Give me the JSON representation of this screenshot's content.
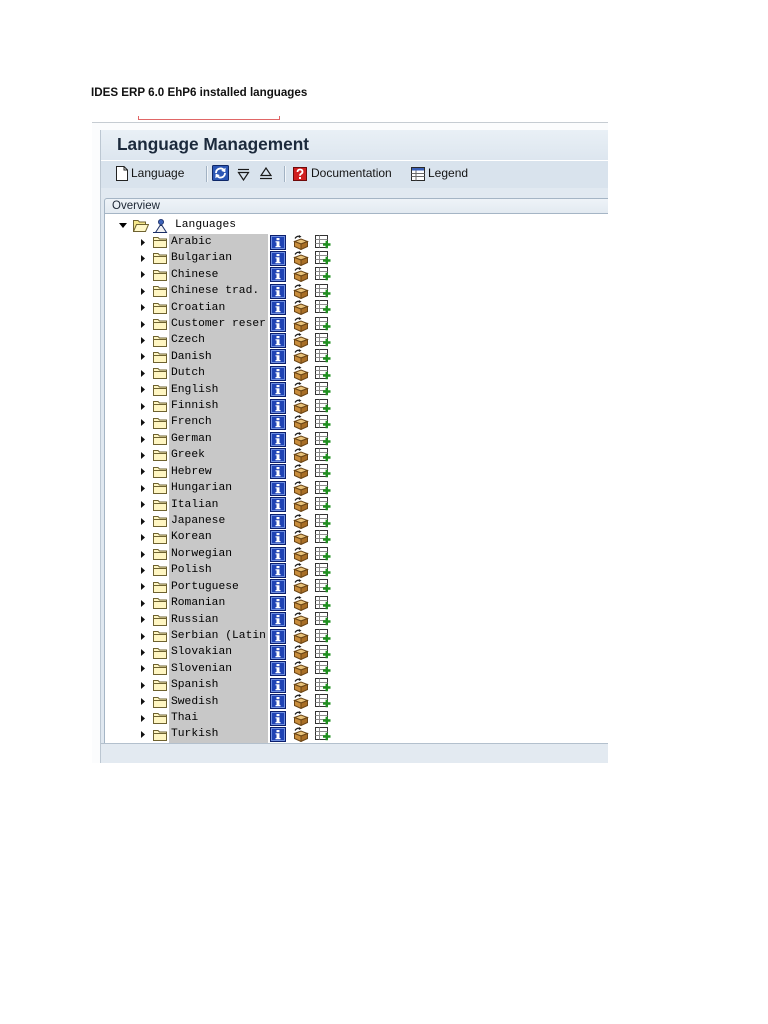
{
  "document": {
    "caption": "IDES ERP 6.0 EhP6 installed languages"
  },
  "window": {
    "title": "Language Management"
  },
  "toolbar": {
    "items": [
      {
        "icon": "new-document-icon",
        "label": "Language"
      },
      {
        "icon": "refresh-icon"
      },
      {
        "icon": "expand-all-icon"
      },
      {
        "icon": "collapse-all-icon"
      },
      {
        "icon": "documentation-icon",
        "label": "Documentation"
      },
      {
        "icon": "legend-icon",
        "label": "Legend"
      }
    ]
  },
  "overview": {
    "header": "Overview",
    "tree": {
      "root": {
        "label": "Languages",
        "icons": [
          "collapse-arrow-icon",
          "open-folder-icon",
          "person-icon"
        ]
      },
      "row_icons": [
        "expand-arrow-icon",
        "folder-icon",
        "info-icon",
        "transport-package-icon",
        "add-entry-icon"
      ],
      "languages": [
        "Arabic",
        "Bulgarian",
        "Chinese",
        "Chinese trad.",
        "Croatian",
        "Customer reser",
        "Czech",
        "Danish",
        "Dutch",
        "English",
        "Finnish",
        "French",
        "German",
        "Greek",
        "Hebrew",
        "Hungarian",
        "Italian",
        "Japanese",
        "Korean",
        "Norwegian",
        "Polish",
        "Portuguese",
        "Romanian",
        "Russian",
        "Serbian (Latin",
        "Slovakian",
        "Slovenian",
        "Spanish",
        "Swedish",
        "Thai",
        "Turkish"
      ]
    }
  },
  "colors": {
    "caption_marker": "#e06666",
    "title_text": "#1c2a3c",
    "title_bar": "#dde6ef",
    "toolbar": "#d9e3ed",
    "info_icon": "#1f43b4",
    "documentation_icon": "#d01f1f",
    "label_column": "#c8c8c8",
    "add_plus": "#1f8f1f"
  }
}
